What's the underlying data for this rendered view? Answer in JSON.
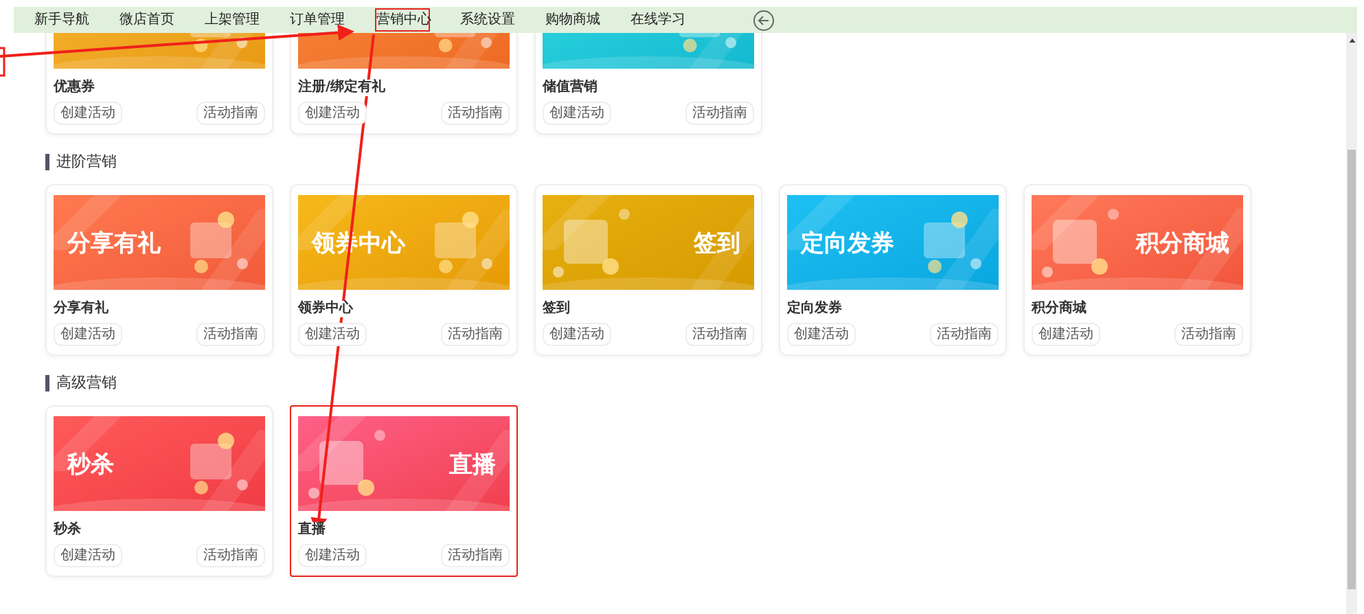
{
  "nav": {
    "items": [
      {
        "label": "新手导航",
        "highlighted": false
      },
      {
        "label": "微店首页",
        "highlighted": false
      },
      {
        "label": "上架管理",
        "highlighted": false
      },
      {
        "label": "订单管理",
        "highlighted": false
      },
      {
        "label": "营销中心",
        "highlighted": true
      },
      {
        "label": "系统设置",
        "highlighted": false
      },
      {
        "label": "购物商城",
        "highlighted": false
      },
      {
        "label": "在线学习",
        "highlighted": false
      }
    ]
  },
  "sections": [
    {
      "cropped": true,
      "cards": [
        {
          "name": "优惠券",
          "create": "创建活动",
          "guide": "活动指南",
          "highlighted": false
        },
        {
          "name": "注册/绑定有礼",
          "create": "创建活动",
          "guide": "活动指南",
          "highlighted": false
        },
        {
          "name": "储值营销",
          "create": "创建活动",
          "guide": "活动指南",
          "highlighted": false
        }
      ]
    },
    {
      "title": "进阶营销",
      "cropped": false,
      "cards": [
        {
          "name": "分享有礼",
          "banner_text": "分享有礼",
          "create": "创建活动",
          "guide": "活动指南",
          "highlighted": false
        },
        {
          "name": "领券中心",
          "banner_text": "领券中心",
          "create": "创建活动",
          "guide": "活动指南",
          "highlighted": false
        },
        {
          "name": "签到",
          "banner_text": "签到",
          "create": "创建活动",
          "guide": "活动指南",
          "highlighted": false
        },
        {
          "name": "定向发券",
          "banner_text": "定向发券",
          "create": "创建活动",
          "guide": "活动指南",
          "highlighted": false
        },
        {
          "name": "积分商城",
          "banner_text": "积分商城",
          "create": "创建活动",
          "guide": "活动指南",
          "highlighted": false
        }
      ]
    },
    {
      "title": "高级营销",
      "cropped": false,
      "cards": [
        {
          "name": "秒杀",
          "banner_text": "秒杀",
          "create": "创建活动",
          "guide": "活动指南",
          "highlighted": false
        },
        {
          "name": "直播",
          "banner_text": "直播",
          "create": "创建活动",
          "guide": "活动指南",
          "highlighted": true
        }
      ]
    }
  ]
}
